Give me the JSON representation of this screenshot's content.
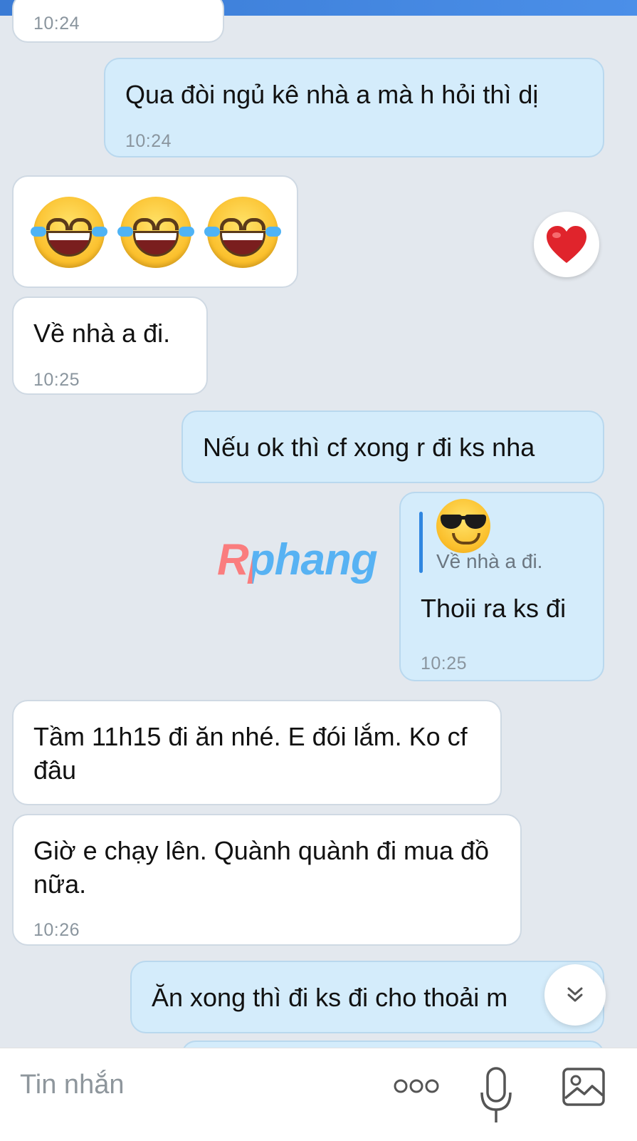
{
  "messages": [
    {
      "time": "10:24"
    },
    {
      "text": "Qua đòi ngủ kê nhà a mà h hỏi thì dị",
      "time": "10:24"
    },
    {
      "emoji": [
        "face-with-tears-of-joy",
        "face-with-tears-of-joy",
        "face-with-tears-of-joy"
      ],
      "reaction": "red-heart"
    },
    {
      "text": "Về nhà a đi.",
      "time": "10:25"
    },
    {
      "text": "Nếu ok thì cf xong r đi ks nha"
    },
    {
      "quote": {
        "emoji": "smiling-face-with-sunglasses",
        "text": "Về nhà a đi."
      },
      "text": "Thoii ra ks đi",
      "time": "10:25"
    },
    {
      "text": "Tầm 11h15 đi ăn nhé. E đói lắm. Ko cf đâu"
    },
    {
      "text": "Giờ e chạy lên. Quành quành đi mua đồ nữa.",
      "time": "10:26"
    },
    {
      "text": "Ăn xong thì đi ks đi cho thoải m"
    }
  ],
  "watermark": "Rphang",
  "composer": {
    "placeholder": "Tin nhắn",
    "more_icon": "more-dots-icon",
    "mic_icon": "microphone-icon",
    "image_icon": "image-icon"
  },
  "colors": {
    "background": "#e3e8ee",
    "incoming": "#ffffff",
    "outgoing": "#d4ecfb",
    "accent": "#2f86e0",
    "heart": "#e0242c"
  }
}
